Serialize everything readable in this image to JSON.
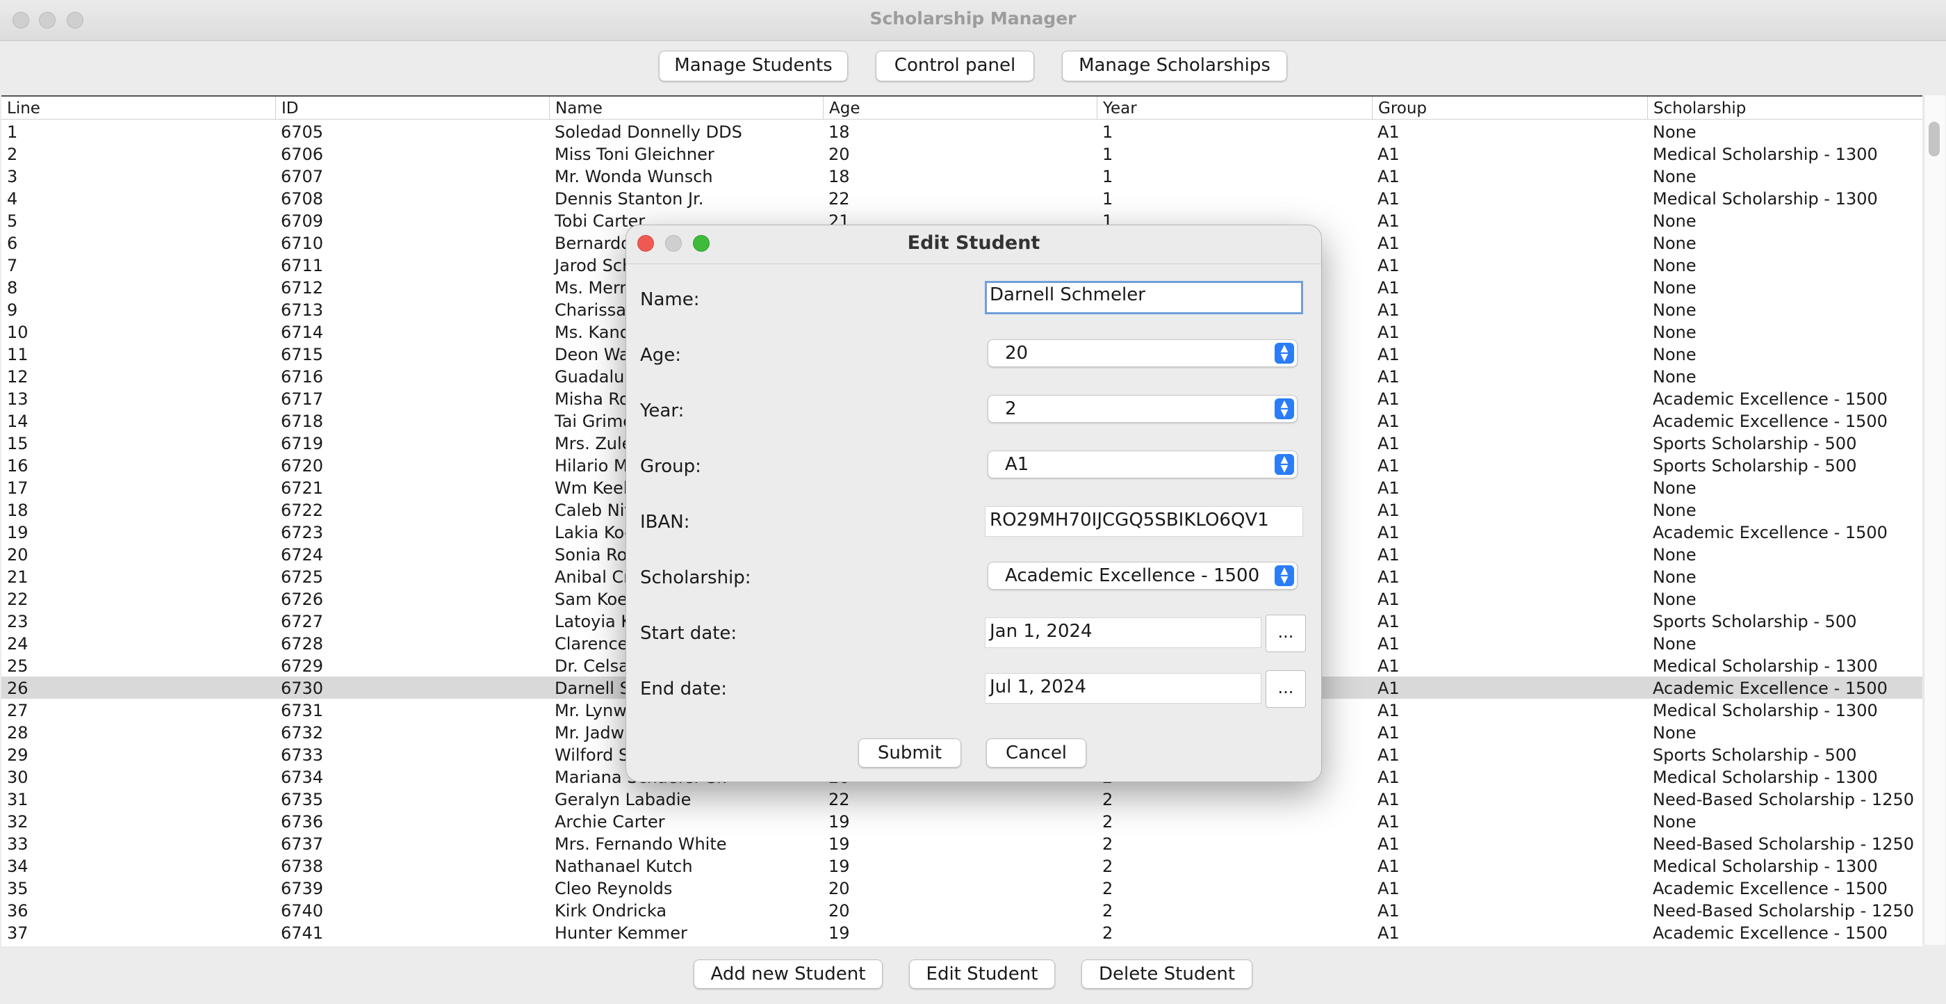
{
  "window": {
    "title": "Scholarship Manager"
  },
  "toolbar": {
    "manage_students": "Manage Students",
    "control_panel": "Control panel",
    "manage_scholarships": "Manage Scholarships"
  },
  "table": {
    "columns": [
      "Line",
      "ID",
      "Name",
      "Age",
      "Year",
      "Group",
      "Scholarship"
    ],
    "selected_line": 26,
    "rows": [
      [
        "1",
        "6705",
        "Soledad Donnelly DDS",
        "18",
        "1",
        "A1",
        "None"
      ],
      [
        "2",
        "6706",
        "Miss Toni Gleichner",
        "20",
        "1",
        "A1",
        "Medical Scholarship - 1300"
      ],
      [
        "3",
        "6707",
        "Mr. Wonda Wunsch",
        "18",
        "1",
        "A1",
        "None"
      ],
      [
        "4",
        "6708",
        "Dennis Stanton Jr.",
        "22",
        "1",
        "A1",
        "Medical Scholarship - 1300"
      ],
      [
        "5",
        "6709",
        "Tobi Carter",
        "21",
        "1",
        "A1",
        "None"
      ],
      [
        "6",
        "6710",
        "Bernardo",
        "",
        "",
        "A1",
        "None"
      ],
      [
        "7",
        "6711",
        "Jarod Sch",
        "",
        "",
        "A1",
        "None"
      ],
      [
        "8",
        "6712",
        "Ms. Merri",
        "",
        "",
        "A1",
        "None"
      ],
      [
        "9",
        "6713",
        "Charissa",
        "",
        "",
        "A1",
        "None"
      ],
      [
        "10",
        "6714",
        "Ms. Kand",
        "",
        "",
        "A1",
        "None"
      ],
      [
        "11",
        "6715",
        "Deon Wat",
        "",
        "",
        "A1",
        "None"
      ],
      [
        "12",
        "6716",
        "Guadalup",
        "",
        "",
        "A1",
        "None"
      ],
      [
        "13",
        "6717",
        "Misha Ro",
        "",
        "",
        "A1",
        "Academic Excellence - 1500"
      ],
      [
        "14",
        "6718",
        "Tai Grime",
        "",
        "",
        "A1",
        "Academic Excellence - 1500"
      ],
      [
        "15",
        "6719",
        "Mrs. Zule",
        "",
        "",
        "A1",
        "Sports Scholarship - 500"
      ],
      [
        "16",
        "6720",
        "Hilario M",
        "",
        "",
        "A1",
        "Sports Scholarship - 500"
      ],
      [
        "17",
        "6721",
        "Wm Keeli",
        "",
        "",
        "A1",
        "None"
      ],
      [
        "18",
        "6722",
        "Caleb Nit",
        "",
        "",
        "A1",
        "None"
      ],
      [
        "19",
        "6723",
        "Lakia Koc",
        "",
        "",
        "A1",
        "Academic Excellence - 1500"
      ],
      [
        "20",
        "6724",
        "Sonia Rov",
        "",
        "",
        "A1",
        "None"
      ],
      [
        "21",
        "6725",
        "Anibal Cr",
        "",
        "",
        "A1",
        "None"
      ],
      [
        "22",
        "6726",
        "Sam Koel",
        "",
        "",
        "A1",
        "None"
      ],
      [
        "23",
        "6727",
        "Latoyia K",
        "",
        "",
        "A1",
        "Sports Scholarship - 500"
      ],
      [
        "24",
        "6728",
        "Clarence",
        "",
        "",
        "A1",
        "None"
      ],
      [
        "25",
        "6729",
        "Dr. Celsa",
        "",
        "",
        "A1",
        "Medical Scholarship - 1300"
      ],
      [
        "26",
        "6730",
        "Darnell Sc",
        "",
        "",
        "A1",
        "Academic Excellence - 1500"
      ],
      [
        "27",
        "6731",
        "Mr. Lynwo",
        "",
        "",
        "A1",
        "Medical Scholarship - 1300"
      ],
      [
        "28",
        "6732",
        "Mr. Jadwi",
        "",
        "",
        "A1",
        "None"
      ],
      [
        "29",
        "6733",
        "Wilford Sv",
        "",
        "",
        "A1",
        "Sports Scholarship - 500"
      ],
      [
        "30",
        "6734",
        "Mariana Schaefer Sr.",
        "20",
        "2",
        "A1",
        "Medical Scholarship - 1300"
      ],
      [
        "31",
        "6735",
        "Geralyn Labadie",
        "22",
        "2",
        "A1",
        "Need-Based Scholarship - 1250"
      ],
      [
        "32",
        "6736",
        "Archie Carter",
        "19",
        "2",
        "A1",
        "None"
      ],
      [
        "33",
        "6737",
        "Mrs. Fernando White",
        "19",
        "2",
        "A1",
        "Need-Based Scholarship - 1250"
      ],
      [
        "34",
        "6738",
        "Nathanael Kutch",
        "19",
        "2",
        "A1",
        "Medical Scholarship - 1300"
      ],
      [
        "35",
        "6739",
        "Cleo Reynolds",
        "20",
        "2",
        "A1",
        "Academic Excellence - 1500"
      ],
      [
        "36",
        "6740",
        "Kirk Ondricka",
        "20",
        "2",
        "A1",
        "Need-Based Scholarship - 1250"
      ],
      [
        "37",
        "6741",
        "Hunter Kemmer",
        "19",
        "2",
        "A1",
        "Academic Excellence - 1500"
      ]
    ]
  },
  "bottom": {
    "add": "Add new Student",
    "edit": "Edit Student",
    "delete": "Delete Student"
  },
  "dialog": {
    "title": "Edit Student",
    "name_label": "Name:",
    "name_value": "Darnell Schmeler",
    "age_label": "Age:",
    "age_value": "20",
    "year_label": "Year:",
    "year_value": "2",
    "group_label": "Group:",
    "group_value": "A1",
    "iban_label": "IBAN:",
    "iban_value": "RO29MH70IJCGQ5SBIKLO6QV1",
    "scholarship_label": "Scholarship:",
    "scholarship_value": "Academic Excellence - 1500",
    "start_label": "Start date:",
    "start_value": "Jan 1, 2024",
    "end_label": "End date:",
    "end_value": "Jul 1, 2024",
    "picker_label": "...",
    "submit": "Submit",
    "cancel": "Cancel"
  },
  "colors": {
    "accent": "#2b7cf7",
    "selected_row": "#d9d9d9",
    "close": "#ee5a52",
    "minimize": "#cfcfcf",
    "zoom": "#3ebb3a"
  }
}
